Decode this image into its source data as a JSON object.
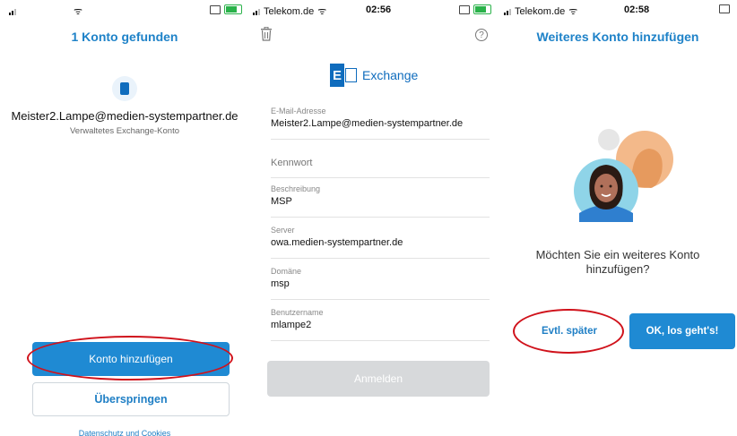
{
  "panel1": {
    "title": "1 Konto gefunden",
    "email": "Meister2.Lampe@medien-systempartner.de",
    "subtitle": "Verwaltetes Exchange-Konto",
    "add_button": "Konto hinzufügen",
    "skip_button": "Überspringen",
    "privacy_link": "Datenschutz und Cookies"
  },
  "panel2": {
    "status": {
      "carrier": "Telekom.de",
      "time": "02:56"
    },
    "brand": "Exchange",
    "fields": [
      {
        "label": "E-Mail-Adresse",
        "value": "Meister2.Lampe@medien-systempartner.de"
      },
      {
        "label": "",
        "placeholder": "Kennwort"
      },
      {
        "label": "Beschreibung",
        "value": "MSP"
      },
      {
        "label": "Server",
        "value": "owa.medien-systempartner.de"
      },
      {
        "label": "Domäne",
        "value": "msp"
      },
      {
        "label": "Benutzername",
        "value": "mlampe2"
      }
    ],
    "signin_button": "Anmelden"
  },
  "panel3": {
    "status": {
      "carrier": "Telekom.de",
      "time": "02:58"
    },
    "title": "Weiteres Konto hinzufügen",
    "question": "Möchten Sie ein weiteres Konto hinzufügen?",
    "later_button": "Evtl. später",
    "ok_button": "OK, los geht's!"
  },
  "colors": {
    "accent": "#1f8ad3",
    "title": "#1e82c8",
    "annotation": "#d0121b",
    "disabled": "#d7d9db"
  }
}
